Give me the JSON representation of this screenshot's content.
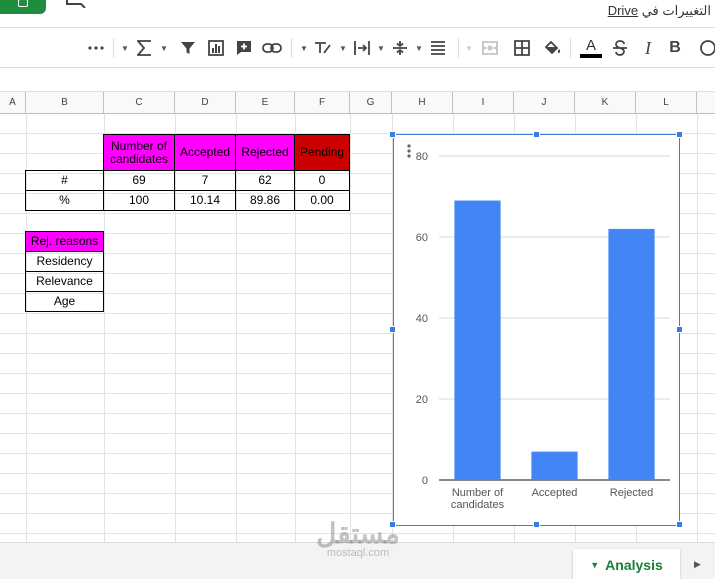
{
  "topbar": {
    "drive_text_prefix": "Drive",
    "drive_text_suffix": "التغييرات في"
  },
  "toolbar": {
    "items": [
      "more-icon",
      "sigma-icon",
      "filter-icon",
      "chart-icon",
      "insert-comment-icon",
      "link-icon",
      "rotate-text-icon",
      "horizontal-align-icon",
      "vertical-align-icon",
      "wrap-icon",
      "merge-icon",
      "borders-icon",
      "fill-color-icon",
      "text-color-icon",
      "strikethrough-icon",
      "italic-icon",
      "bold-icon"
    ],
    "italic_label": "I",
    "bold_label": "B",
    "text_color_label": "A"
  },
  "columns": [
    "A",
    "B",
    "C",
    "D",
    "E",
    "F",
    "G",
    "H",
    "I",
    "J",
    "K",
    "L"
  ],
  "table": {
    "headers": [
      "Number of candidates",
      "Accepted",
      "Rejected",
      "Pending"
    ],
    "header_colors": [
      "#ff00ff",
      "#ff00ff",
      "#ff00ff",
      "#cc0000"
    ],
    "rows": [
      {
        "label": "#",
        "values": [
          "69",
          "7",
          "62",
          "0"
        ]
      },
      {
        "label": "%",
        "values": [
          "100",
          "10.14",
          "89.86",
          "0.00"
        ]
      }
    ]
  },
  "reasons": {
    "header": "Rej. reasons",
    "header_color": "#ff00ff",
    "items": [
      "Residency",
      "Relevance",
      "Age"
    ]
  },
  "chart_data": {
    "type": "bar",
    "categories": [
      "Number of candidates",
      "Accepted",
      "Rejected"
    ],
    "category_lines": [
      [
        "Number of",
        "candidates"
      ],
      [
        "Accepted"
      ],
      [
        "Rejected"
      ]
    ],
    "values": [
      69,
      7,
      62
    ],
    "ylim": [
      0,
      80
    ],
    "yticks": [
      0,
      20,
      40,
      60,
      80
    ],
    "grid": true,
    "bar_color": "#4285f4",
    "title": "",
    "xlabel": "",
    "ylabel": ""
  },
  "sheet_tab": {
    "label": "Analysis",
    "color": "#188038"
  },
  "watermark": {
    "arabic": "مستقل",
    "latin": "mostaql.com"
  }
}
